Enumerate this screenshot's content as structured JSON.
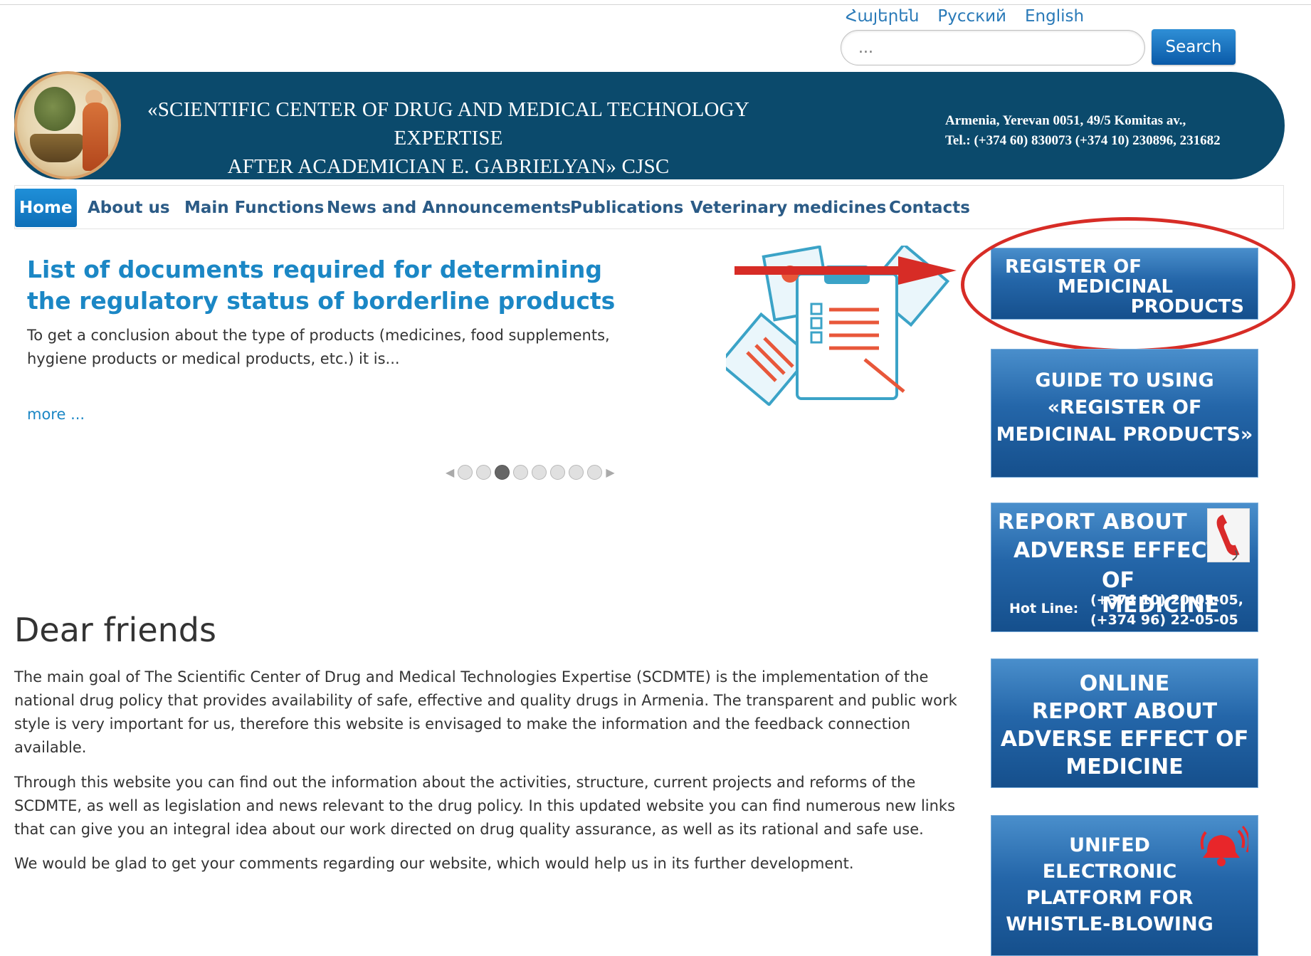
{
  "languages": [
    "Հայերեն",
    "Русский",
    "English"
  ],
  "search": {
    "placeholder": "...",
    "button_label": "Search"
  },
  "header": {
    "title_line1": "«SCIENTIFIC CENTER OF DRUG AND MEDICAL TECHNOLOGY EXPERTISE",
    "title_line2": "AFTER ACADEMICIAN E. GABRIELYAN»  CJSC",
    "address": "Armenia, Yerevan 0051, 49/5 Komitas av.,",
    "phones": "Tel.: (+374 60) 830073 (+374 10) 230896, 231682"
  },
  "nav": {
    "items": [
      "Home",
      "About us",
      "Main Functions",
      "News and Announcements",
      "Publications",
      "Veterinary medicines",
      "Contacts"
    ],
    "active": "Home"
  },
  "slider": {
    "title": "List of documents required for determining the regulatory status of borderline products",
    "text": "To get a conclusion about the type of products (medicines, food supplements, hygiene products or medical products, etc.) it is...",
    "more": "more ...",
    "dots_total": 8,
    "active_dot": 3
  },
  "sidebar": {
    "register": {
      "line1": "REGISTER OF",
      "line2": "MEDICINAL",
      "line3": "PRODUCTS"
    },
    "guide": {
      "line1": "GUIDE TO USING",
      "line2": "«REGISTER OF",
      "line3": "MEDICINAL PRODUCTS»"
    },
    "report": {
      "line1": "REPORT ABOUT",
      "line2": "ADVERSE  EFFECT",
      "line3": "OF MEDICINE",
      "hotline_label": "Hot Line:",
      "phone1": "(+374 10) 20-05-05,",
      "phone2": "(+374 96) 22-05-05"
    },
    "online": {
      "line1": "ONLINE",
      "line2": "REPORT ABOUT",
      "line3": "ADVERSE EFFECT OF",
      "line4": "MEDICINE"
    },
    "whistle": {
      "line1": "UNIFED",
      "line2": "ELECTRONIC",
      "line3": "PLATFORM FOR",
      "line4": "WHISTLE-BLOWING"
    }
  },
  "main": {
    "heading": "Dear friends",
    "p1": "The main goal of The Scientific Center of Drug and Medical Technologies Expertise (SCDMTE) is the implementation of the national drug policy that provides availability of safe, effective and quality drugs in Armenia. The transparent and public work style is very important for us, therefore this website is envisaged to make the information and the feedback connection available.",
    "p2": "Through this website you can find out the information about the activities, structure, current projects and reforms of the SCDMTE, as well as legislation and news relevant to the drug policy. In this updated website you can find numerous new links that can give you an integral idea about our work directed on drug quality assurance, as well as its rational and safe use.",
    "p3": "We would be glad to get your comments regarding our website, which would help us in its further development."
  },
  "colors": {
    "banner": "#0b4a6c",
    "nav_text": "#2b5b86",
    "link": "#1b87c5",
    "annotation": "#d72c26"
  }
}
